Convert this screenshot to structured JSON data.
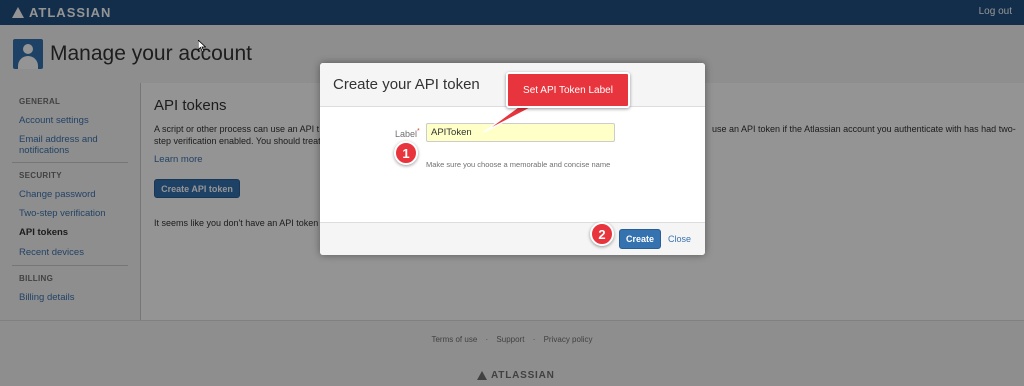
{
  "topbar": {
    "brand": "ATLASSIAN",
    "logout": "Log out"
  },
  "header": {
    "title": "Manage your account"
  },
  "sidebar": {
    "general_heading": "GENERAL",
    "general_items": [
      {
        "label": "Account settings"
      },
      {
        "label": "Email address and notifications"
      }
    ],
    "security_heading": "SECURITY",
    "security_items": [
      {
        "label": "Change password"
      },
      {
        "label": "Two-step verification"
      },
      {
        "label": "API tokens",
        "active": true
      },
      {
        "label": "Recent devices"
      }
    ],
    "billing_heading": "BILLING",
    "billing_items": [
      {
        "label": "Billing details"
      }
    ]
  },
  "main": {
    "title": "API tokens",
    "desc_left_1": "A script or other process can use an API t",
    "desc_left_2": "step verification enabled. You should treat",
    "desc_right_1": "use an API token if the Atlassian account you authenticate with has had two-",
    "learn_more": "Learn more",
    "create_button": "Create API token",
    "empty_text": "It seems like you don't have an API token"
  },
  "dialog": {
    "title": "Create your API token",
    "label": "Label",
    "required_mark": "*",
    "input_value": "APIToken",
    "hint": "Make sure you choose a memorable and concise name",
    "create_button": "Create",
    "close_link": "Close"
  },
  "annotations": {
    "callout": "Set API Token Label",
    "step1": "1",
    "step2": "2"
  },
  "footer": {
    "links": [
      "Terms of use",
      "Support",
      "Privacy policy"
    ],
    "separator": "·",
    "brand": "ATLASSIAN"
  },
  "colors": {
    "topbar": "#205081",
    "primary_button": "#3572b0",
    "link": "#3b73af",
    "annotation": "#e8343c",
    "input_highlight": "#ffffc8"
  }
}
